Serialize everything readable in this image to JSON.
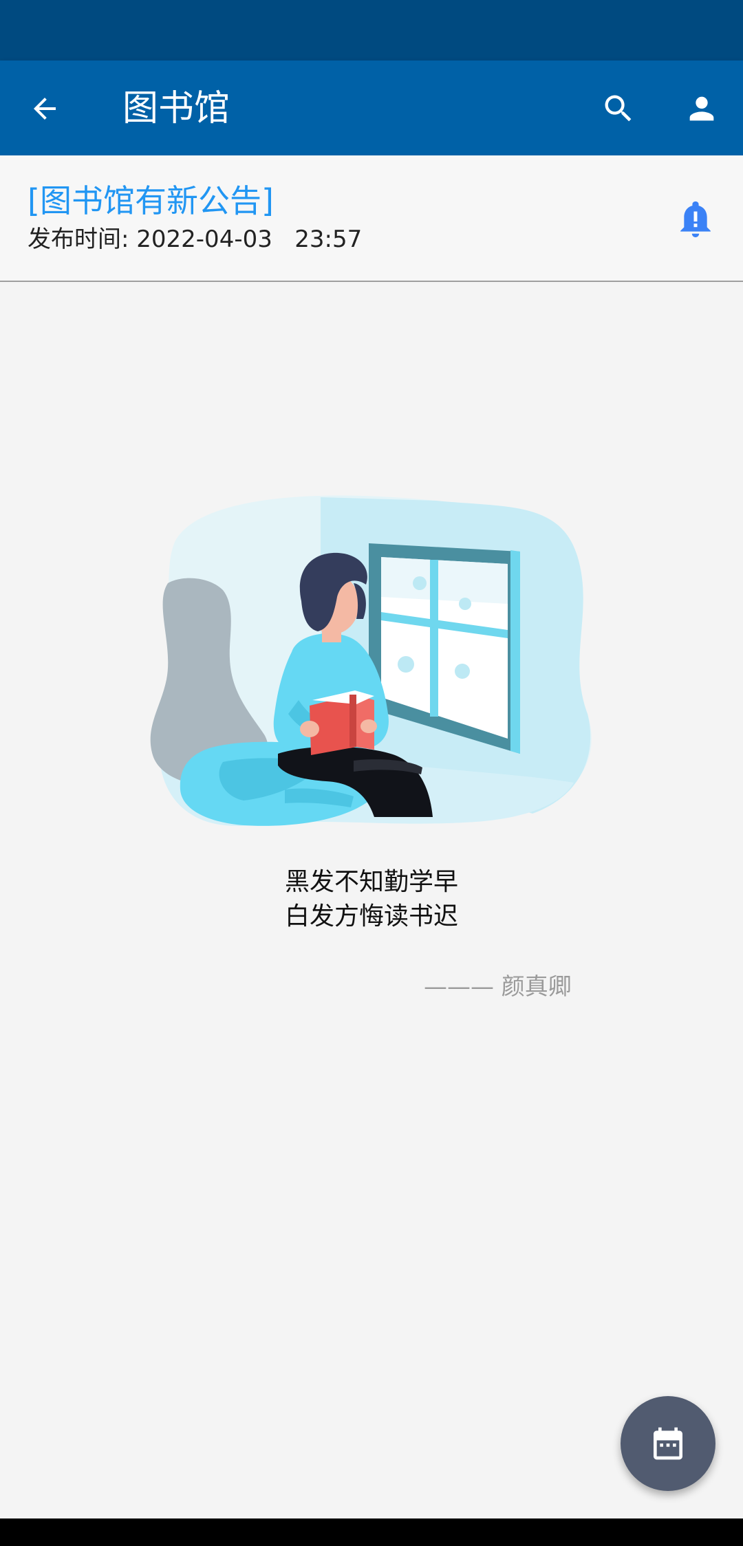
{
  "app_bar": {
    "title": "图书馆",
    "back_icon": "arrow-left-icon",
    "search_icon": "search-icon",
    "account_icon": "account-icon",
    "background": "#0061a7"
  },
  "notice": {
    "title": "[图书馆有新公告]",
    "published_label": "发布时间: 2022-04-03   23:57",
    "bell_icon": "bell-alert-icon",
    "title_color": "#2196f3"
  },
  "illustration": {
    "icon": "reading-woman-illustration"
  },
  "quote": {
    "line1": "黑发不知勤学早",
    "line2": "白发方悔读书迟",
    "author": "——— 颜真卿"
  },
  "fab": {
    "icon": "calendar-icon",
    "color": "#515b70"
  }
}
